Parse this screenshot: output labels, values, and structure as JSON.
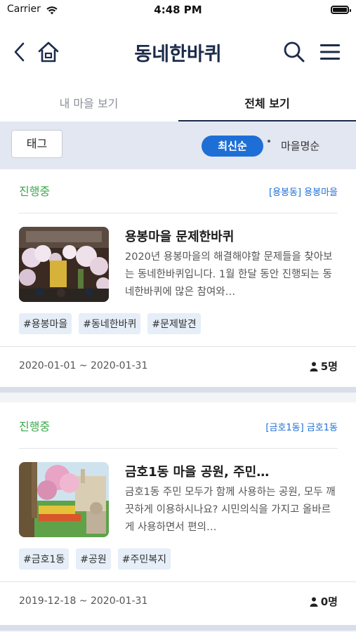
{
  "status_bar": {
    "carrier": "Carrier",
    "time": "4:48 PM"
  },
  "navbar": {
    "title": "동네한바퀴",
    "icons": [
      "back-icon",
      "home-icon",
      "search-icon",
      "menu-icon"
    ]
  },
  "tabs": [
    {
      "label": "내 마을 보기",
      "active": false
    },
    {
      "label": "전체 보기",
      "active": true
    }
  ],
  "filter": {
    "tag_label": "태그",
    "sort_active": "최신순",
    "sort_other": "마을명순"
  },
  "colors": {
    "accent": "#1d6fd6",
    "status_green": "#3aa84a",
    "title_navy": "#1c2b4a",
    "filter_bg": "#e3e7f1"
  },
  "cards": [
    {
      "status": "진행중",
      "location": "[용봉동] 용봉마을",
      "title": "용봉마을 문제한바퀴",
      "description": "2020년 용봉마을의 해결해야할 문제들을 찾아보는 동네한바퀴입니다. 1월 한달 동안 진행되는 동네한바퀴에 많은 참여와…",
      "tags": [
        "#용봉마을",
        "#동네한바퀴",
        "#문제발견"
      ],
      "date_range": "2020-01-01 ~ 2020-01-31",
      "participants": "5명"
    },
    {
      "status": "진행중",
      "location": "[금호1동] 금호1동",
      "title": "금호1동 마을 공원, 주민…",
      "description": "금호1동 주민 모두가 함께 사용하는 공원, 모두 깨끗하게 이용하시나요? 시민의식을 가지고 올바르게 사용하면서 편의…",
      "tags": [
        "#금호1동",
        "#공원",
        "#주민복지"
      ],
      "date_range": "2019-12-18 ~ 2020-01-31",
      "participants": "0명"
    }
  ]
}
